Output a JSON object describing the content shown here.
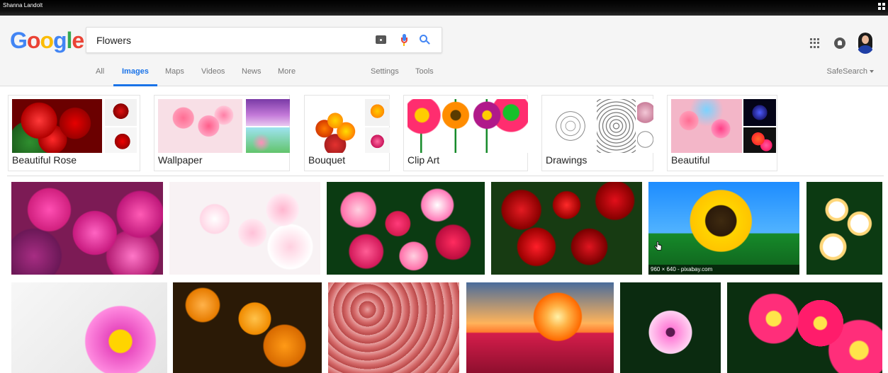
{
  "window": {
    "user": "Shanna Landolt"
  },
  "brand": {
    "letters": [
      "G",
      "o",
      "o",
      "g",
      "l",
      "e"
    ],
    "colors": [
      "#4285f4",
      "#ea4335",
      "#fbbc05",
      "#4285f4",
      "#34a853",
      "#ea4335"
    ]
  },
  "search": {
    "query": "Flowers"
  },
  "header_icons": {
    "apps": "apps-grid-icon",
    "notifications": "notifications-icon",
    "avatar": "account-avatar"
  },
  "tabs": {
    "all": "All",
    "images": "Images",
    "maps": "Maps",
    "videos": "Videos",
    "news": "News",
    "more": "More",
    "settings": "Settings",
    "tools": "Tools",
    "safesearch": "SafeSearch"
  },
  "categories": [
    {
      "label": "Beautiful Rose"
    },
    {
      "label": "Wallpaper"
    },
    {
      "label": "Bouquet"
    },
    {
      "label": "Clip Art"
    },
    {
      "label": "Drawings"
    },
    {
      "label": "Beautiful"
    }
  ],
  "results": [
    {
      "name": "pink-dahlias"
    },
    {
      "name": "cherry-blossoms"
    },
    {
      "name": "cosmos-flowers"
    },
    {
      "name": "red-roses"
    },
    {
      "name": "sunflower",
      "caption": "960 × 640 - pixabay.com"
    },
    {
      "name": "plumeria"
    },
    {
      "name": "pink-daisy"
    },
    {
      "name": "orange-flowers-butterfly"
    },
    {
      "name": "rose-wall"
    },
    {
      "name": "lotus-sunset"
    },
    {
      "name": "pink-dahlia"
    },
    {
      "name": "gerbera-daisies"
    }
  ]
}
